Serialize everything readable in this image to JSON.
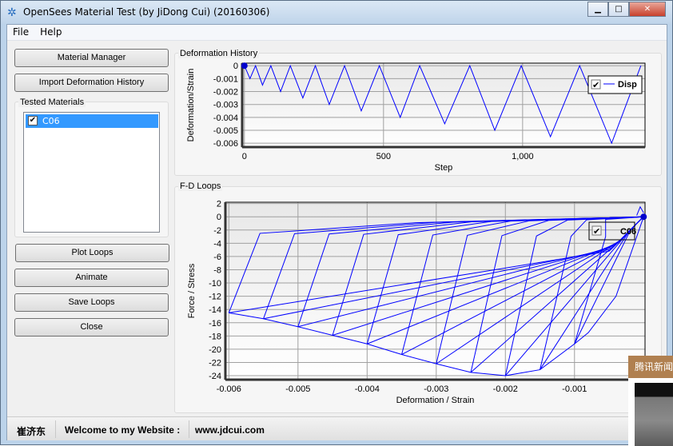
{
  "window": {
    "title": "OpenSees Material Test (by JiDong Cui) (20160306)",
    "minimize": "▁",
    "maximize": "□",
    "close": "✕"
  },
  "menu": [
    "File",
    "Help"
  ],
  "buttons": {
    "material_manager": "Material Manager",
    "import": "Import Deformation History",
    "plot": "Plot Loops",
    "animate": "Animate",
    "save": "Save Loops",
    "close": "Close"
  },
  "tested_materials": {
    "label": "Tested Materials",
    "items": [
      {
        "name": "C06",
        "checked": true
      }
    ]
  },
  "status": {
    "author": "崔济东",
    "welcome": "Welcome to my Website :",
    "url": "www.jdcui.com"
  },
  "popup": {
    "title": "腾讯新闻"
  },
  "colors": {
    "series": "#0000ff",
    "marker": "#0000cc"
  },
  "chart_data": [
    {
      "type": "line",
      "title": "Deformation History",
      "xlabel": "Step",
      "ylabel": "Deformation/Strain",
      "xlim": [
        -8,
        1440
      ],
      "ylim": [
        -0.0063,
        0.0002
      ],
      "xticks": [
        0,
        500,
        1000
      ],
      "xtick_labels": [
        "0",
        "500",
        "1,000"
      ],
      "yticks": [
        0,
        -0.001,
        -0.002,
        -0.003,
        -0.004,
        -0.005,
        -0.006
      ],
      "ytick_labels": [
        "0",
        "-0.001",
        "-0.002",
        "-0.003",
        "-0.004",
        "-0.005",
        "-0.006"
      ],
      "grid": true,
      "legend": {
        "placement": "top-right",
        "entries": [
          "Disp"
        ]
      },
      "series": [
        {
          "name": "Disp",
          "x": [
            0,
            20,
            40,
            65,
            95,
            130,
            165,
            210,
            255,
            305,
            360,
            420,
            485,
            560,
            630,
            720,
            810,
            900,
            995,
            1100,
            1205,
            1320,
            1425
          ],
          "y": [
            0,
            -0.001,
            0,
            -0.0015,
            0,
            -0.002,
            0,
            -0.0025,
            0,
            -0.003,
            0,
            -0.0035,
            0,
            -0.004,
            0,
            -0.0045,
            0,
            -0.005,
            0,
            -0.0055,
            0,
            -0.006,
            0
          ]
        }
      ]
    },
    {
      "type": "line",
      "title": "F-D Loops",
      "xlabel": "Deformation / Strain",
      "ylabel": "Force /  Stress",
      "xlim": [
        -0.00605,
        2e-05
      ],
      "ylim": [
        -24.6,
        2.2
      ],
      "xticks": [
        -0.006,
        -0.005,
        -0.004,
        -0.003,
        -0.002,
        -0.001
      ],
      "xtick_labels": [
        "-0.006",
        "-0.005",
        "-0.004",
        "-0.003",
        "-0.002",
        "-0.001"
      ],
      "yticks": [
        2,
        0,
        -2,
        -4,
        -6,
        -8,
        -10,
        -12,
        -14,
        -16,
        -18,
        -20,
        -22,
        -24
      ],
      "ytick_labels": [
        "2",
        "0",
        "-2",
        "-4",
        "-6",
        "-8",
        "-10",
        "-12",
        "-14",
        "-16",
        "-18",
        "-20",
        "-22",
        "-24"
      ],
      "grid": true,
      "legend": {
        "placement": "top-right",
        "entries": [
          "C06"
        ]
      },
      "envelope_peaks": {
        "strain": [
          -0.001,
          -0.0015,
          -0.002,
          -0.0025,
          -0.003,
          -0.0035,
          -0.004,
          -0.0045,
          -0.005,
          -0.0055,
          -0.006
        ],
        "stress": [
          -19.2,
          -23.1,
          -24,
          -23.5,
          -22.2,
          -20.8,
          -19.2,
          -17.9,
          -16.6,
          -15.4,
          -14.5
        ]
      }
    }
  ]
}
